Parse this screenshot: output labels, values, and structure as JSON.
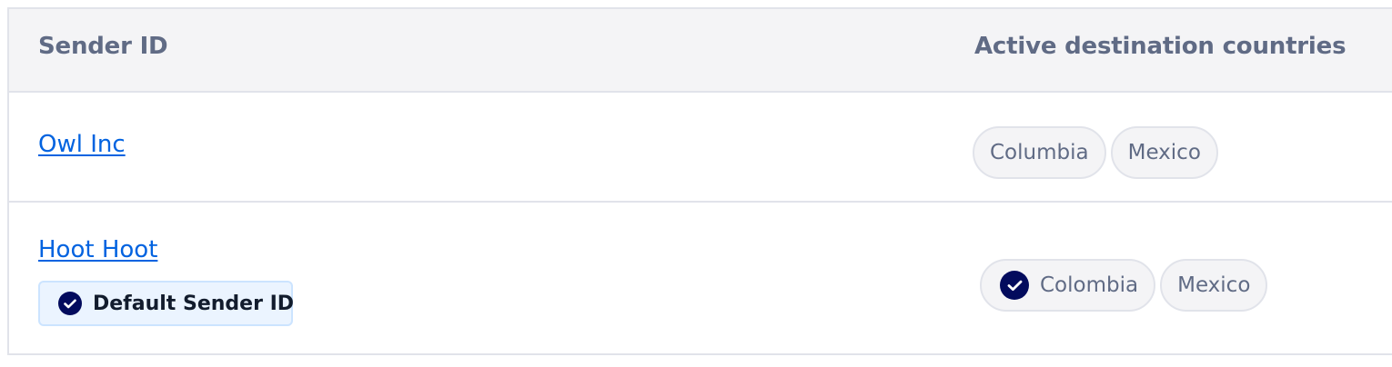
{
  "table": {
    "headers": {
      "sender_id": "Sender ID",
      "countries": "Active destination countries"
    },
    "rows": [
      {
        "sender_name": "Owl Inc",
        "default_badge": null,
        "countries": [
          {
            "label": "Columbia",
            "verified": false
          },
          {
            "label": "Mexico",
            "verified": false
          }
        ]
      },
      {
        "sender_name": "Hoot Hoot",
        "default_badge": "Default Sender ID",
        "countries": [
          {
            "label": "Colombia",
            "verified": true
          },
          {
            "label": "Mexico",
            "verified": false
          }
        ]
      }
    ]
  },
  "colors": {
    "link": "#0263e0",
    "header_text": "#606b85",
    "check_icon": "#030b5d",
    "badge_bg": "#ebf4ff"
  },
  "icons": {
    "verified": "check-circle-icon"
  }
}
